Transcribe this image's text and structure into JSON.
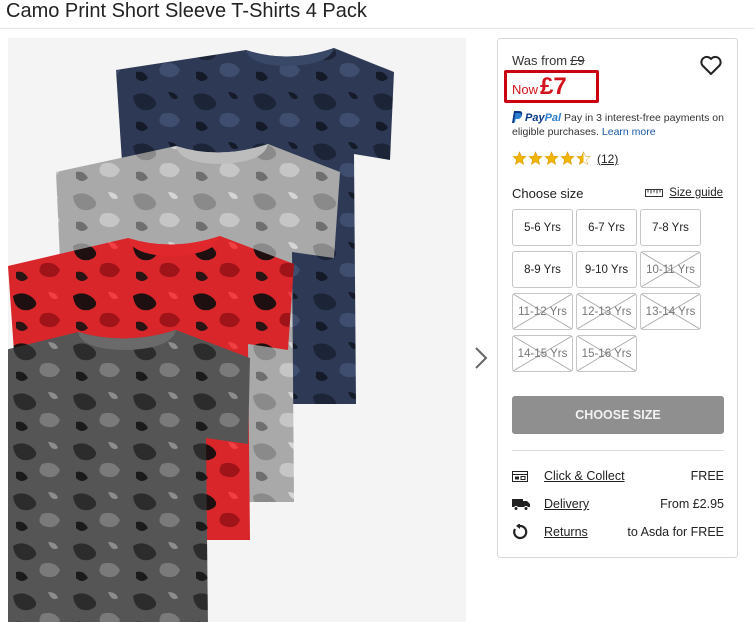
{
  "product": {
    "title": "Camo Print Short Sleeve T-Shirts 4 Pack"
  },
  "pricing": {
    "was_label": "Was from",
    "was_price": "£9",
    "now_label": "Now",
    "now_price": "£7",
    "highlight_color": "#c8000f"
  },
  "paypal": {
    "logo_text_a": "Pay",
    "logo_text_b": "Pal",
    "message": "Pay in 3 interest-free payments on eligible purchases.",
    "learn_more": "Learn more"
  },
  "rating": {
    "stars": 4.5,
    "out_of": 5,
    "count": "(12)"
  },
  "size_section": {
    "heading": "Choose size",
    "size_guide": "Size guide",
    "sizes": [
      {
        "label": "5-6 Yrs",
        "available": true
      },
      {
        "label": "6-7 Yrs",
        "available": true
      },
      {
        "label": "7-8 Yrs",
        "available": true
      },
      {
        "label": "8-9 Yrs",
        "available": true
      },
      {
        "label": "9-10 Yrs",
        "available": true
      },
      {
        "label": "10-11 Yrs",
        "available": false
      },
      {
        "label": "11-12 Yrs",
        "available": false
      },
      {
        "label": "12-13 Yrs",
        "available": false
      },
      {
        "label": "13-14 Yrs",
        "available": false
      },
      {
        "label": "14-15 Yrs",
        "available": false
      },
      {
        "label": "15-16 Yrs",
        "available": false
      }
    ]
  },
  "cta": {
    "label": "CHOOSE SIZE"
  },
  "fulfilment": [
    {
      "icon": "click-collect-icon",
      "label": "Click & Collect",
      "value": "FREE"
    },
    {
      "icon": "delivery-truck-icon",
      "label": "Delivery",
      "value": "From £2.95"
    },
    {
      "icon": "returns-icon",
      "label": "Returns",
      "value": "to Asda for FREE"
    }
  ],
  "colors": {
    "star": "#f2b300",
    "price_red": "#d3131b",
    "button_gray": "#8f8f8f"
  }
}
